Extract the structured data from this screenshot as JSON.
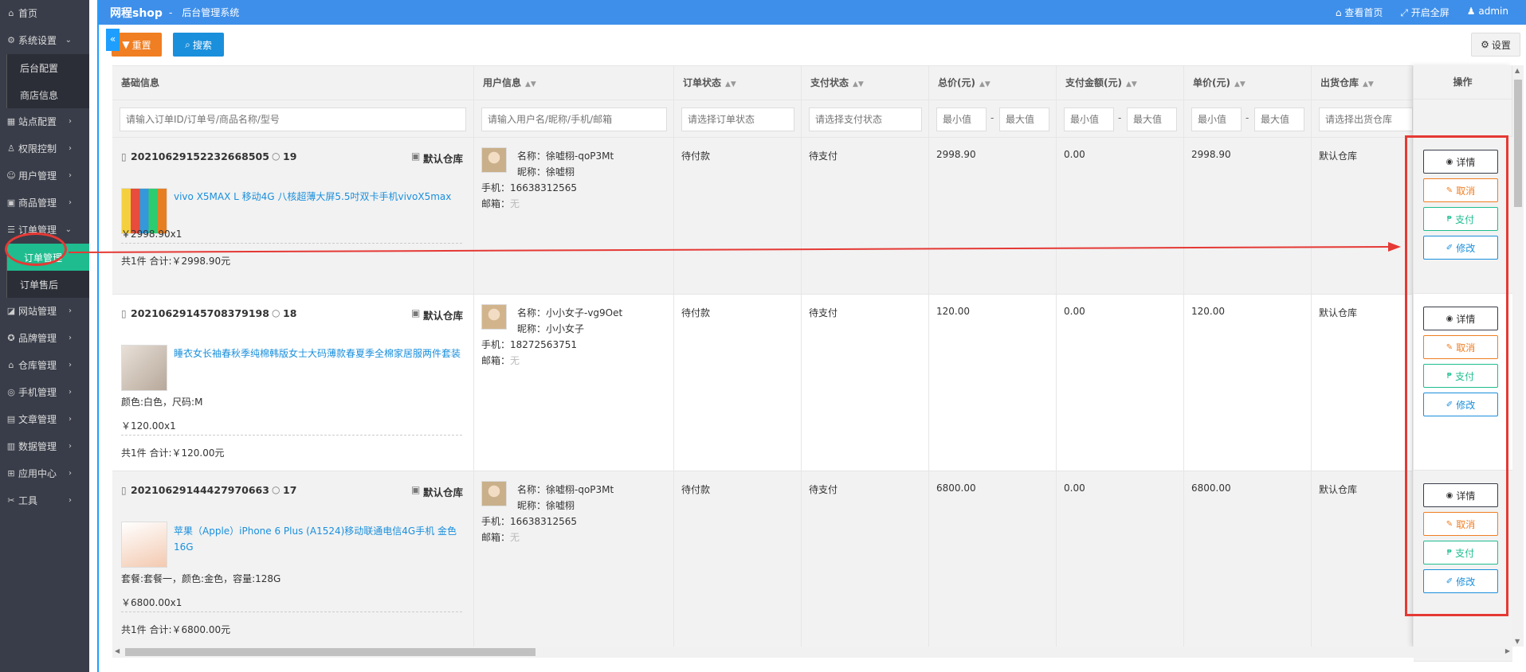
{
  "sidebar": {
    "items": [
      {
        "label": "首页",
        "icon": "home-icon",
        "glyph": "⌂",
        "arrow": ""
      },
      {
        "label": "系统设置",
        "icon": "gear-icon",
        "glyph": "⚙",
        "arrow": "⌄"
      },
      {
        "label": "站点配置",
        "icon": "grid-icon",
        "glyph": "▦",
        "arrow": "›"
      },
      {
        "label": "权限控制",
        "icon": "user-icon",
        "glyph": "♙",
        "arrow": "›"
      },
      {
        "label": "用户管理",
        "icon": "users-icon",
        "glyph": "☺",
        "arrow": "›"
      },
      {
        "label": "商品管理",
        "icon": "goods-icon",
        "glyph": "▣",
        "arrow": "›"
      },
      {
        "label": "订单管理",
        "icon": "order-icon",
        "glyph": "☰",
        "arrow": "⌄"
      },
      {
        "label": "网站管理",
        "icon": "site-icon",
        "glyph": "◪",
        "arrow": "›"
      },
      {
        "label": "品牌管理",
        "icon": "brand-icon",
        "glyph": "✪",
        "arrow": "›"
      },
      {
        "label": "仓库管理",
        "icon": "warehouse-icon",
        "glyph": "⌂",
        "arrow": "›"
      },
      {
        "label": "手机管理",
        "icon": "phone-icon",
        "glyph": "◎",
        "arrow": "›"
      },
      {
        "label": "文章管理",
        "icon": "article-icon",
        "glyph": "▤",
        "arrow": "›"
      },
      {
        "label": "数据管理",
        "icon": "data-icon",
        "glyph": "▥",
        "arrow": "›"
      },
      {
        "label": "应用中心",
        "icon": "apps-icon",
        "glyph": "⊞",
        "arrow": "›"
      },
      {
        "label": "工具",
        "icon": "tool-icon",
        "glyph": "✂",
        "arrow": "›"
      }
    ],
    "system_sub": [
      "后台配置",
      "商店信息"
    ],
    "order_sub": [
      "订单管理",
      "订单售后"
    ]
  },
  "topbar": {
    "brand": "网程shop",
    "dash": "-",
    "subtitle": "后台管理系统",
    "view_home": "查看首页",
    "fullscreen": "开启全屏",
    "admin": "admin"
  },
  "toolbar": {
    "reset": "重置",
    "search": "搜索",
    "settings": "设置"
  },
  "table": {
    "headers": [
      "基础信息",
      "用户信息",
      "订单状态",
      "支付状态",
      "总价(元)",
      "支付金额(元)",
      "单价(元)",
      "出货仓库"
    ],
    "op_header": "操作",
    "filters": {
      "base": "请输入订单ID/订单号/商品名称/型号",
      "user": "请输入用户名/昵称/手机/邮箱",
      "order_status": "请选择订单状态",
      "pay_status": "请选择支付状态",
      "min": "最小值",
      "max": "最大值",
      "dash": "-",
      "warehouse": "请选择出货仓库"
    },
    "rows": [
      {
        "order_no": "20210629152232668505",
        "order_id": "19",
        "warehouse_tag": "默认仓库",
        "product": "vivo X5MAX L 移动4G 八核超薄大屏5.5吋双卡手机vivoX5max",
        "spec": "",
        "price_qty": "￥2998.90x1",
        "summary": "共1件 合计:￥2998.90元",
        "user_name": "名称：徐嘘栩-qoP3Mt",
        "user_nick": "昵称：徐嘘栩",
        "user_phone": "手机：16638312565",
        "email_label": "邮箱：",
        "email_value": "无",
        "order_status": "待付款",
        "pay_status": "待支付",
        "total": "2998.90",
        "paid": "0.00",
        "unit": "2998.90",
        "warehouse": "默认仓库"
      },
      {
        "order_no": "20210629145708379198",
        "order_id": "18",
        "warehouse_tag": "默认仓库",
        "product": "睡衣女长袖春秋季纯棉韩版女士大码薄款春夏季全棉家居服两件套装",
        "spec": "颜色:白色，尺码:M",
        "price_qty": "￥120.00x1",
        "summary": "共1件 合计:￥120.00元",
        "user_name": "名称：小小女子-vg9Oet",
        "user_nick": "昵称：小小女子",
        "user_phone": "手机：18272563751",
        "email_label": "邮箱：",
        "email_value": "无",
        "order_status": "待付款",
        "pay_status": "待支付",
        "total": "120.00",
        "paid": "0.00",
        "unit": "120.00",
        "warehouse": "默认仓库"
      },
      {
        "order_no": "20210629144427970663",
        "order_id": "17",
        "warehouse_tag": "默认仓库",
        "product": "苹果（Apple）iPhone 6 Plus (A1524)移动联通电信4G手机 金色 16G",
        "spec": "套餐:套餐一，颜色:金色，容量:128G",
        "price_qty": "￥6800.00x1",
        "summary": "共1件 合计:￥6800.00元",
        "user_name": "名称：徐嘘栩-qoP3Mt",
        "user_nick": "昵称：徐嘘栩",
        "user_phone": "手机：16638312565",
        "email_label": "邮箱：",
        "email_value": "无",
        "order_status": "待付款",
        "pay_status": "待支付",
        "total": "6800.00",
        "paid": "0.00",
        "unit": "6800.00",
        "warehouse": "默认仓库"
      }
    ],
    "actions": {
      "detail": "详情",
      "cancel": "取消",
      "pay": "支付",
      "edit": "修改"
    }
  }
}
